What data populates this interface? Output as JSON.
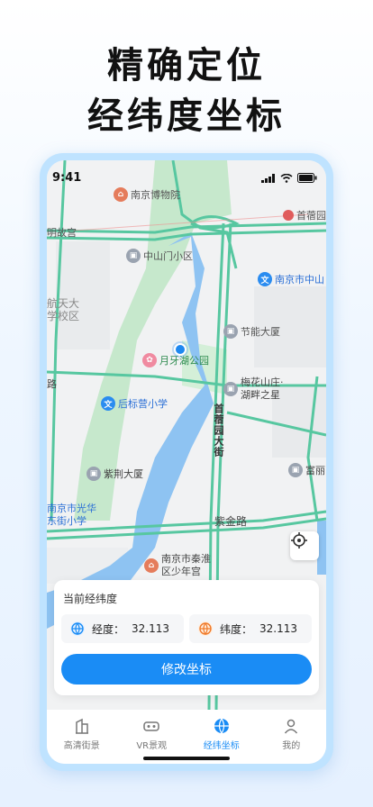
{
  "headline": {
    "line1": "精确定位",
    "line2": "经纬度坐标"
  },
  "status_bar": {
    "time": "9:41"
  },
  "map": {
    "pois": [
      {
        "id": "museum",
        "label": "南京博物院",
        "icon": "landmark-icon"
      },
      {
        "id": "shouxiao",
        "label": "首蓿园",
        "icon": "landmark-icon"
      },
      {
        "id": "gugong",
        "label": "明故宫",
        "icon": ""
      },
      {
        "id": "zhongshanmen",
        "label": "中山门小区",
        "icon": "building-icon"
      },
      {
        "id": "school1",
        "label": "南京市中山",
        "icon": "school-icon"
      },
      {
        "id": "hangtian",
        "label": "航天大\n学校区",
        "icon": ""
      },
      {
        "id": "jieneng",
        "label": "节能大厦",
        "icon": "building-icon"
      },
      {
        "id": "yueyahu",
        "label": "月牙湖公园",
        "icon": "park-icon"
      },
      {
        "id": "road_left",
        "label": "路",
        "icon": ""
      },
      {
        "id": "meihua",
        "label": "梅花山庄·\n湖畔之星",
        "icon": "building-icon"
      },
      {
        "id": "houbiaoying",
        "label": "后标营小学",
        "icon": "school-icon"
      },
      {
        "id": "zijing",
        "label": "紫荆大厦",
        "icon": "building-icon"
      },
      {
        "id": "fuli",
        "label": "富丽",
        "icon": "building-icon"
      },
      {
        "id": "guanghua",
        "label": "南京市光华\n东街小学",
        "icon": ""
      },
      {
        "id": "zijinlu",
        "label": "紫金路",
        "icon": ""
      },
      {
        "id": "qinhuai",
        "label": "南京市秦淮\n区少年宫",
        "icon": "landmark-icon"
      }
    ],
    "street_vertical": "首蓿园大街"
  },
  "card": {
    "title": "当前经纬度",
    "longitude_label": "经度：",
    "longitude_value": "32.113",
    "latitude_label": "纬度：",
    "latitude_value": "32.113",
    "button_label": "修改坐标"
  },
  "tabs": [
    {
      "label": "高清街景",
      "icon": "building-icon",
      "active": false
    },
    {
      "label": "VR景观",
      "icon": "vr-icon",
      "active": true
    },
    {
      "label": "经纬坐标",
      "icon": "globe-icon",
      "active": true
    },
    {
      "label": "我的",
      "icon": "person-icon",
      "active": false
    }
  ],
  "colors": {
    "accent": "#1a8cf5",
    "water": "#8ec3f2",
    "park": "#bfe6c6",
    "road": "#57c7a0"
  }
}
